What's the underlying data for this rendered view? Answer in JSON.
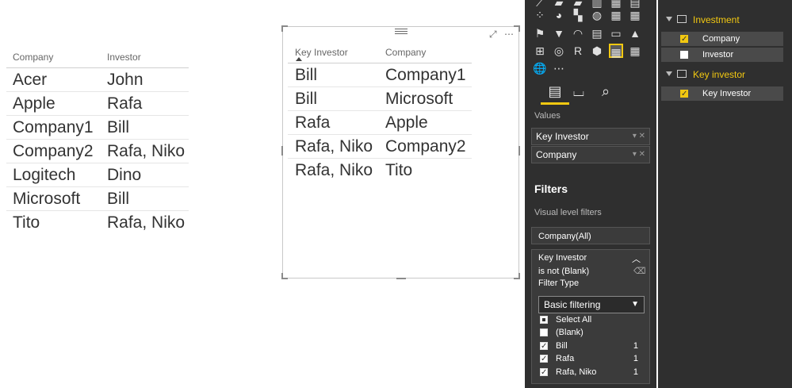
{
  "left_table": {
    "headers": [
      "Company",
      "Investor"
    ],
    "rows": [
      [
        "Acer",
        "John"
      ],
      [
        "Apple",
        "Rafa"
      ],
      [
        "Company1",
        "Bill"
      ],
      [
        "Company2",
        "Rafa, Niko"
      ],
      [
        "Logitech",
        "Dino"
      ],
      [
        "Microsoft",
        "Bill"
      ],
      [
        "Tito",
        "Rafa, Niko"
      ]
    ]
  },
  "visual_table": {
    "headers": [
      "Key Investor",
      "Company"
    ],
    "rows": [
      [
        "Bill",
        "Company1"
      ],
      [
        "Bill",
        "Microsoft"
      ],
      [
        "Rafa",
        "Apple"
      ],
      [
        "Rafa, Niko",
        "Company2"
      ],
      [
        "Rafa, Niko",
        "Tito"
      ]
    ],
    "icons": [
      "focus-mode-icon",
      "more-options-icon"
    ]
  },
  "viz_panel": {
    "values_label": "Values",
    "wells": [
      "Key Investor",
      "Company"
    ],
    "filters_title": "Filters",
    "visual_level_filters": "Visual level filters",
    "filter_all": "Company(All)",
    "filter_card": {
      "field": "Key Investor",
      "condition": "is not (Blank)",
      "filter_type_label": "Filter Type",
      "filter_type_value": "Basic filtering",
      "options": [
        {
          "label": "Select All",
          "count": "",
          "state": "partial"
        },
        {
          "label": "(Blank)",
          "count": "",
          "state": "unchecked"
        },
        {
          "label": "Bill",
          "count": "1",
          "state": "checked"
        },
        {
          "label": "Rafa",
          "count": "1",
          "state": "checked"
        },
        {
          "label": "Rafa, Niko",
          "count": "1",
          "state": "checked"
        }
      ]
    }
  },
  "fields_panel": {
    "groups": [
      {
        "name": "Investment",
        "fields": [
          {
            "label": "Company",
            "checked": true
          },
          {
            "label": "Investor",
            "checked": false
          }
        ]
      },
      {
        "name": "Key investor",
        "fields": [
          {
            "label": "Key Investor",
            "checked": true
          }
        ]
      }
    ]
  },
  "colors": {
    "accent": "#f2c811",
    "panel_dark": "#2f2f2f"
  }
}
